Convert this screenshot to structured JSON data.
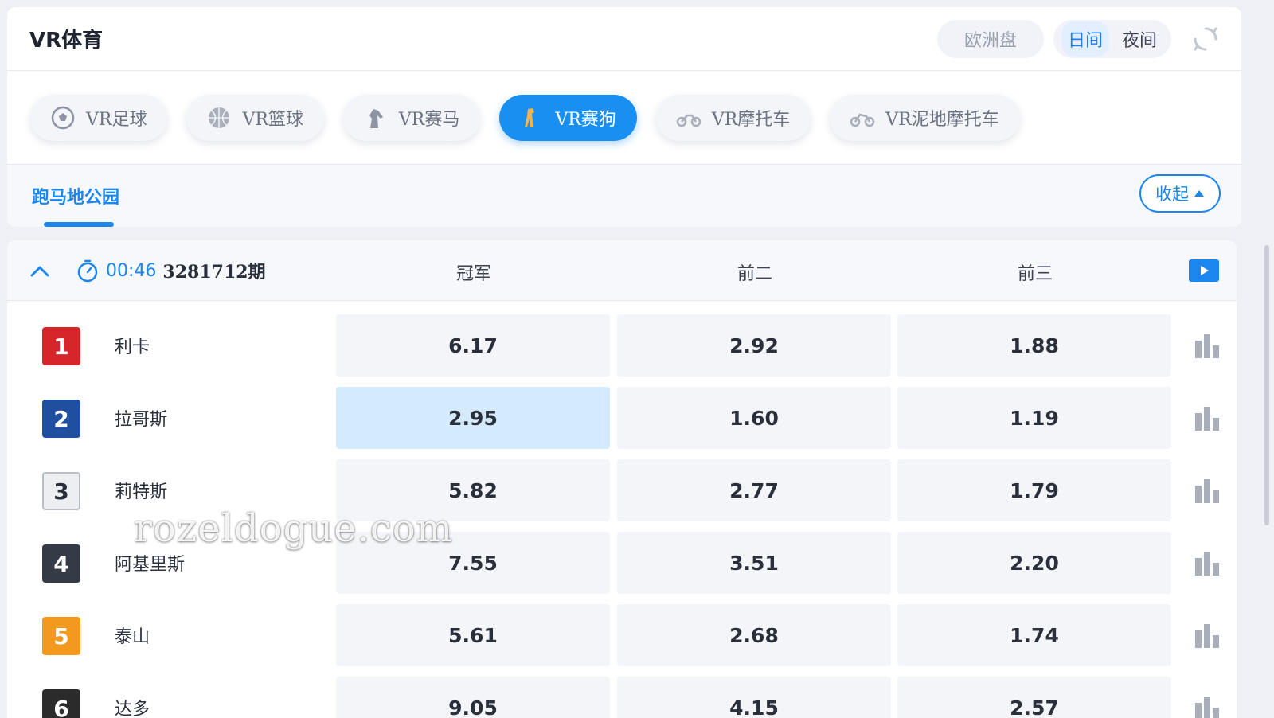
{
  "app": {
    "title": "VR体育"
  },
  "header": {
    "odds_format": "欧洲盘",
    "day_label": "日间",
    "night_label": "夜间",
    "refresh_icon": "refresh-icon"
  },
  "tabs": [
    {
      "label": "VR足球",
      "icon": "soccer-ball-icon",
      "active": false
    },
    {
      "label": "VR篮球",
      "icon": "basketball-icon",
      "active": false
    },
    {
      "label": "VR赛马",
      "icon": "horse-icon",
      "active": false
    },
    {
      "label": "VR赛狗",
      "icon": "greyhound-icon",
      "active": true
    },
    {
      "label": "VR摩托车",
      "icon": "motorcycle-icon",
      "active": false
    },
    {
      "label": "VR泥地摩托车",
      "icon": "dirt-bike-icon",
      "active": false
    }
  ],
  "venue": {
    "name": "跑马地公园",
    "collapse_label": "收起"
  },
  "race": {
    "countdown": "00:46",
    "issue": "3281712期",
    "columns": [
      "冠军",
      "前二",
      "前三"
    ],
    "runners": [
      {
        "number": "1",
        "name": "利卡",
        "color": "#d6262b",
        "odds": [
          "6.17",
          "2.92",
          "1.88"
        ]
      },
      {
        "number": "2",
        "name": "拉哥斯",
        "color": "#1f4f9e",
        "odds": [
          "2.95",
          "1.60",
          "1.19"
        ],
        "selected": 0
      },
      {
        "number": "3",
        "name": "莉特斯",
        "color": "#eceef2",
        "odds": [
          "5.82",
          "2.77",
          "1.79"
        ]
      },
      {
        "number": "4",
        "name": "阿基里斯",
        "color": "#343a46",
        "odds": [
          "7.55",
          "3.51",
          "2.20"
        ]
      },
      {
        "number": "5",
        "name": "泰山",
        "color": "#f39a1e",
        "odds": [
          "5.61",
          "2.68",
          "1.74"
        ]
      },
      {
        "number": "6",
        "name": "达多",
        "color": "#2b2b2b",
        "odds": [
          "9.05",
          "4.15",
          "2.57"
        ]
      }
    ]
  },
  "watermark": "rozeldogue.com"
}
